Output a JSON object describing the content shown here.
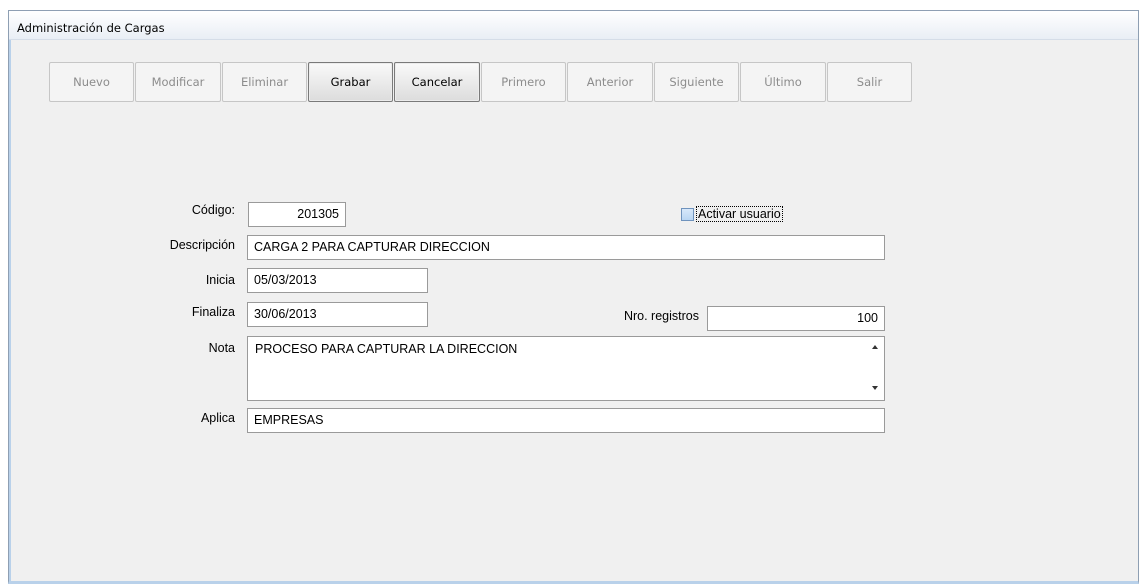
{
  "window": {
    "title": "Administración de Cargas"
  },
  "toolbar": {
    "nuevo": "Nuevo",
    "modificar": "Modificar",
    "eliminar": "Eliminar",
    "grabar": "Grabar",
    "cancelar": "Cancelar",
    "primero": "Primero",
    "anterior": "Anterior",
    "siguiente": "Siguiente",
    "ultimo": "Último",
    "salir": "Salir"
  },
  "form": {
    "codigo_label": "Código:",
    "codigo_value": "201305",
    "activar_label": "Activar usuario",
    "activar_checked": false,
    "descripcion_label": "Descripción",
    "descripcion_value": "CARGA 2 PARA CAPTURAR DIRECCION",
    "inicia_label": "Inicia",
    "inicia_value": "05/03/2013",
    "finaliza_label": "Finaliza",
    "finaliza_value": "30/06/2013",
    "nro_registros_label": "Nro. registros",
    "nro_registros_value": "100",
    "nota_label": "Nota",
    "nota_value": "PROCESO PARA CAPTURAR LA DIRECCION",
    "aplica_label": "Aplica",
    "aplica_value": "EMPRESAS"
  }
}
